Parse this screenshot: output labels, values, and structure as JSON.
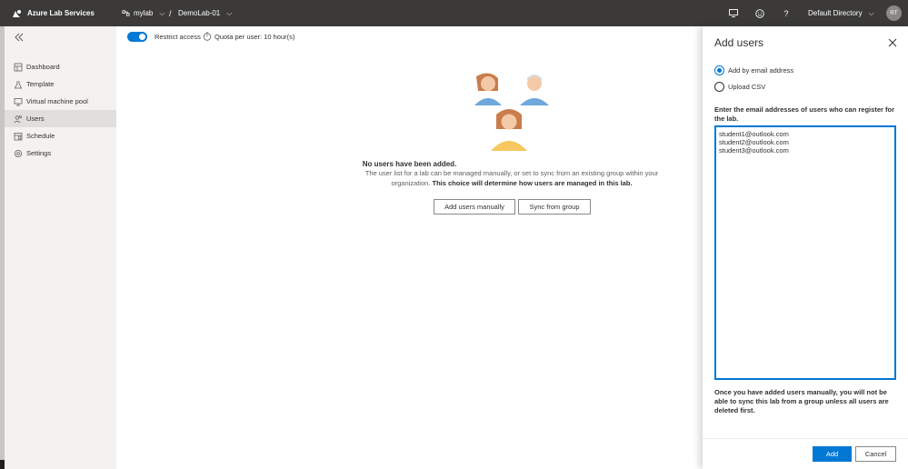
{
  "topbar": {
    "app_title": "Azure Lab Services",
    "lab_account": "mylab",
    "separator": "/",
    "lab_name": "DemoLab-01",
    "directory": "Default Directory",
    "avatar_initials": "RT",
    "bg_color": "#3b3a39"
  },
  "sidebar": {
    "items": [
      {
        "label": "Dashboard",
        "icon": "dashboard-icon"
      },
      {
        "label": "Template",
        "icon": "flask-icon"
      },
      {
        "label": "Virtual machine pool",
        "icon": "monitor-icon"
      },
      {
        "label": "Users",
        "icon": "users-icon",
        "active": true
      },
      {
        "label": "Schedule",
        "icon": "calendar-icon"
      },
      {
        "label": "Settings",
        "icon": "gear-icon"
      }
    ]
  },
  "toolbar": {
    "restrict_label": "Restrict access",
    "restrict_on": true,
    "quota_label": "Quota per user: 10 hour(s)"
  },
  "empty_state": {
    "title": "No users have been added.",
    "description": "The user list for a lab can be managed manually, or set to sync from an existing group within your organization.",
    "description_bold": "This choice will determine how users are managed in this lab.",
    "add_manual_label": "Add users manually",
    "sync_label": "Sync from group"
  },
  "panel": {
    "title": "Add users",
    "option_email": "Add by email address",
    "option_csv": "Upload CSV",
    "selected_option": "email",
    "field_label": "Enter the email addresses of users who can register for the lab.",
    "emails_value": "student1@outlook.com\nstudent2@outlook.com\nstudent3@outlook.com",
    "note": "Once you have added users manually, you will not be able to sync this lab from a group unless all users are deleted first.",
    "add_label": "Add",
    "cancel_label": "Cancel",
    "accent_color": "#0078d4"
  }
}
